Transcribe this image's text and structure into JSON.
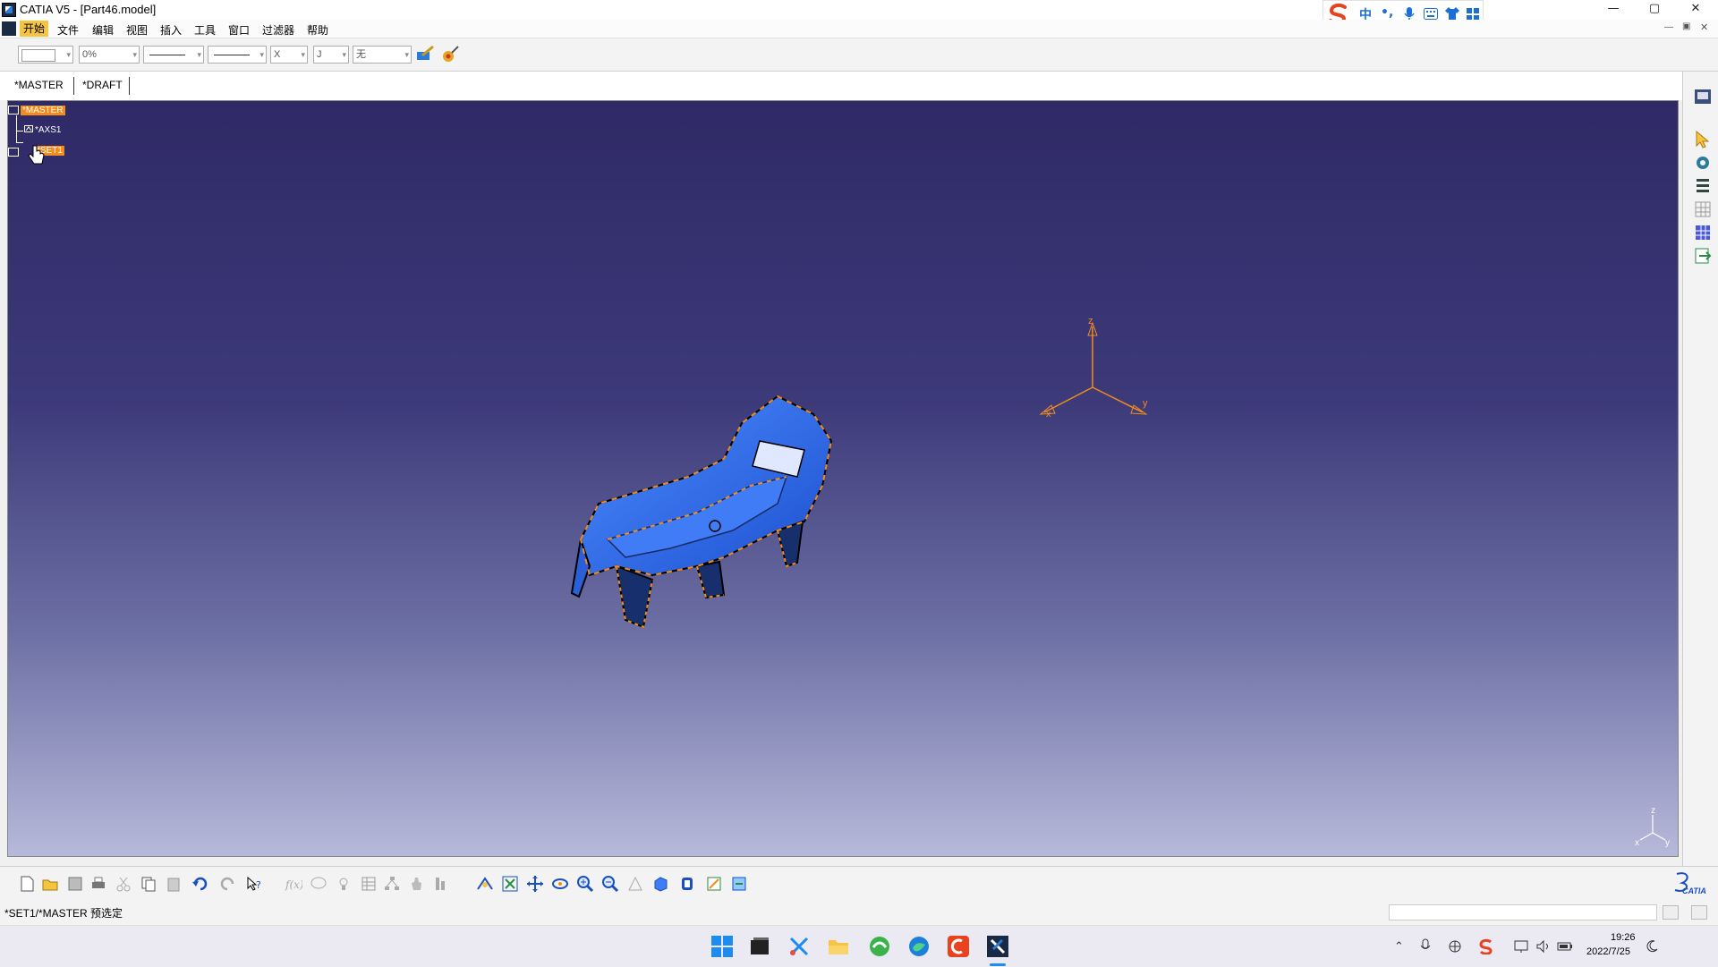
{
  "window": {
    "title": "CATIA V5 - [Part46.model]",
    "controls": {
      "minimize": "—",
      "restore": "▢",
      "close": "✕"
    }
  },
  "ime": {
    "mode": "中",
    "punct": "•,"
  },
  "menu": [
    "开始",
    "文件",
    "编辑",
    "视图",
    "插入",
    "工具",
    "窗口",
    "过滤器",
    "帮助"
  ],
  "toolbar": {
    "percent": "0%",
    "none_label": "无",
    "x_mark": "X",
    "layer_glyph": "J"
  },
  "tabs": [
    "*MASTER",
    "*DRAFT"
  ],
  "tree": {
    "root": "*MASTER",
    "axis": "*AXS1",
    "set": "*SET1"
  },
  "axes3d": {
    "x": "x",
    "y": "y",
    "z": "z"
  },
  "compass": {
    "x": "x",
    "y": "y",
    "z": "z"
  },
  "status": {
    "text": "*SET1/*MASTER 预选定"
  },
  "clock": {
    "time": "19:26",
    "date": "2022/7/25"
  },
  "brand": {
    "logo_text": "CATIA"
  },
  "colors": {
    "accent": "#f28c1c",
    "model_blue": "#2a6ef2",
    "viewport_top": "#2f2a66",
    "viewport_bottom": "#b7b9da"
  }
}
